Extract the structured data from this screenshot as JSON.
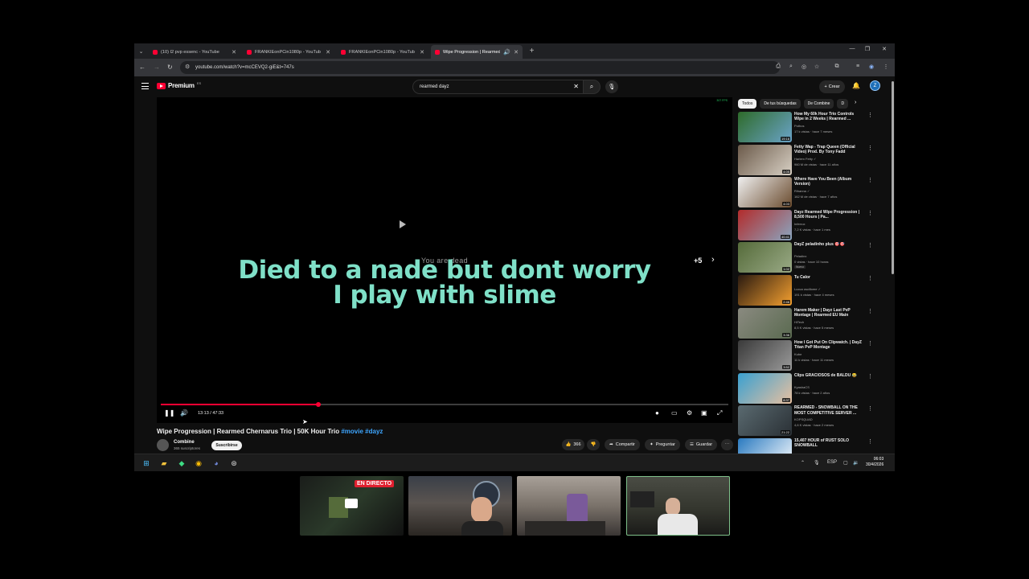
{
  "browser": {
    "tabs": [
      {
        "title": "(10) I2 pvp essenc - YouTube",
        "active": false
      },
      {
        "title": "FRANKIEonPCin1080p - YouTub",
        "active": false
      },
      {
        "title": "FRANKIEonPCin1080p - YouTub",
        "active": false
      },
      {
        "title": "Wipe Progression | Rearmed",
        "active": true
      }
    ],
    "url": "youtube.com/watch?v=mcCEVQ2-giE&t=747s"
  },
  "youtube": {
    "logo_text": "Premium",
    "logo_region": "ES",
    "search_query": "rearmed dayz",
    "create_label": "Crear",
    "avatar_letter": "Z"
  },
  "player": {
    "overlay_text": "You are dead",
    "caption_line1": "Died to a nade but dont worry",
    "caption_line2": "I play with slime",
    "skip_label": "+5",
    "time_display": "13:13 / 47:33",
    "progress_fraction": 0.278,
    "stats_text": "307 FPS"
  },
  "video": {
    "title": "Wipe Progression | Rearmed Chernarus Trio | 50K Hour Trio",
    "tags": "#movie #dayz",
    "channel": "Combine",
    "subscribers": "365 suscriptores",
    "subscribe_label": "Suscribirse",
    "likes": "366",
    "share_label": "Compartir",
    "ask_label": "Preguntar",
    "save_label": "Guardar"
  },
  "sidebar": {
    "chips": [
      "Todos",
      "De tus búsquedas",
      "De Combine",
      "D"
    ],
    "recommendations": [
      {
        "title": "How My 60k Hour Trio Controls Wipe in 2 Weeks | Rearmed ...",
        "channel": "Pothos",
        "meta": "17 k vistas · hace 7 meses",
        "duration": "19:16",
        "badge": "",
        "colors": [
          "#2e6b2a",
          "#6aa3c8"
        ]
      },
      {
        "title": "Fetty Wap - Trap Queen (Official Video) Prod. By Tony Fadd",
        "channel": "Harlem Fetty ✓",
        "meta": "960 M de vistas · hace 11 años",
        "duration": "4:05",
        "badge": "",
        "colors": [
          "#6b5a4a",
          "#d8d0c4"
        ]
      },
      {
        "title": "Where Have You Been (Album Version)",
        "channel": "Rihanna ✓",
        "meta": "162 M de vistas · hace 7 años",
        "duration": "4:03",
        "badge": "",
        "colors": [
          "#f0f0f0",
          "#6a4b2e"
        ]
      },
      {
        "title": "Dayz Rearmed Wipe Progression | 8,500 Hours | Pa...",
        "channel": "Inferrox",
        "meta": "7,2 K vistas · hace 1 mes",
        "duration": "40:41",
        "badge": "",
        "colors": [
          "#b32b2b",
          "#8aa6c0"
        ]
      },
      {
        "title": "DayZ peladinho plus 🎯🎯",
        "channel": "Peladinx",
        "meta": "0 vistas · hace 10 horas",
        "duration": "1:02",
        "badge": "Nuevo",
        "colors": [
          "#556b3a",
          "#9aaa86"
        ]
      },
      {
        "title": "Tu Calor",
        "channel": "Lucca oscillome ✓",
        "meta": "191 k vistas · hace 4 meses",
        "duration": "2:46",
        "badge": "",
        "colors": [
          "#2a1a10",
          "#f4a030"
        ]
      },
      {
        "title": "Harem Maker | Dayz Last PvP Montage | Rearmed EU Main",
        "channel": "HiTech",
        "meta": "8,5 K vistas · hace 5 meses",
        "duration": "3:36",
        "badge": "",
        "colors": [
          "#8a8a80",
          "#5a6a50"
        ]
      },
      {
        "title": "How I Got Put On Clipwatch. | DayZ Titan PvP Montage",
        "channel": "Kube",
        "meta": "11 k vistas · hace 11 meses",
        "duration": "3:52",
        "badge": "",
        "colors": [
          "#3a3a3a",
          "#9a9a9a"
        ]
      },
      {
        "title": "Clips GRACIOSOS de BALDU 😂",
        "channel": "KyashaCS",
        "meta": "78 k vistas · hace 2 años",
        "duration": "8:37",
        "badge": "",
        "colors": [
          "#3aa0d0",
          "#e8c0a0"
        ]
      },
      {
        "title": "REARMED - SNOWBALL ON THE MOST COMPETITIVE SERVER ...",
        "channel": "KOPSQUAD",
        "meta": "4,6 K vistas · hace 2 meses",
        "duration": "21:22",
        "badge": "",
        "colors": [
          "#5a6a70",
          "#2a3035"
        ]
      },
      {
        "title": "15,407 HOUR of RUST SOLO SNOWBALL",
        "channel": "",
        "meta": "",
        "duration": "",
        "badge": "",
        "colors": [
          "#2a7ac0",
          "#ffffff"
        ]
      }
    ]
  },
  "taskbar": {
    "lang": "ESP",
    "time": "06:03",
    "date": "30/4/2026"
  },
  "stream": {
    "live_label": "EN DIRECTO"
  }
}
